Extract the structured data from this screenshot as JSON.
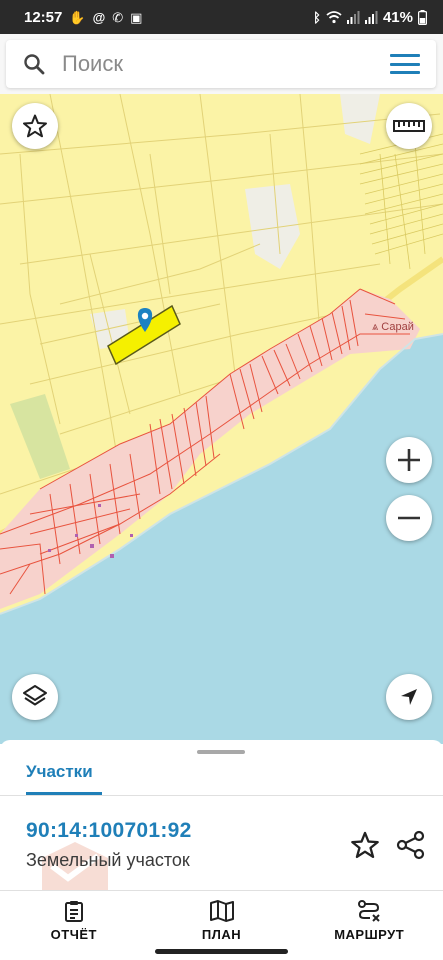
{
  "status_bar": {
    "time": "12:57",
    "left_icons": [
      "hand-icon",
      "at-icon",
      "wifi-calling-icon",
      "image-icon"
    ],
    "right_icons": [
      "bluetooth-icon",
      "wifi-icon",
      "signal-icon",
      "signal-icon"
    ],
    "battery": "41%"
  },
  "search": {
    "placeholder": "Поиск",
    "left_icon": "search-icon",
    "menu_icon": "menu-icon"
  },
  "map": {
    "place_label": "Сарай",
    "buttons": {
      "favorite": "star-icon",
      "ruler": "ruler-icon",
      "zoom_in": "plus-icon",
      "zoom_out": "minus-icon",
      "layers": "layers-icon",
      "locate": "navigation-arrow-icon"
    },
    "colors": {
      "land": "#fbf3a6",
      "parcel_outline": "#e2d277",
      "water": "#aad9e5",
      "built_area": "#f7d2cc",
      "built_outline": "#e8533e",
      "selected_parcel": "#f5f000",
      "marker": "#1b82c2"
    }
  },
  "sheet": {
    "tab": "Участки",
    "cadastral_number": "90:14:100701:92",
    "object_type": "Земельный участок",
    "accent": "#1f7fb8"
  },
  "nav": {
    "items": [
      {
        "label": "ОТЧЁТ",
        "icon": "report-icon"
      },
      {
        "label": "ПЛАН",
        "icon": "map-icon"
      },
      {
        "label": "МАРШРУТ",
        "icon": "route-icon"
      }
    ]
  }
}
